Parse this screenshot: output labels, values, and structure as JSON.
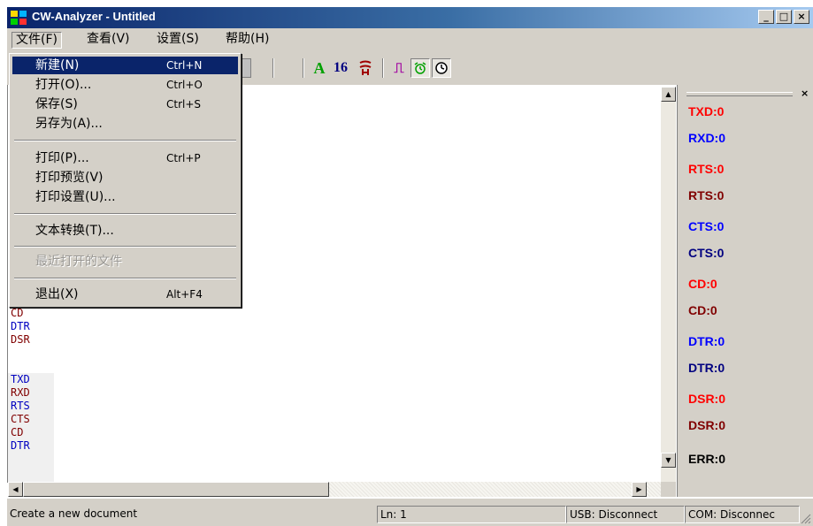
{
  "window": {
    "title": "CW-Analyzer - Untitled",
    "btn_min": "_",
    "btn_max": "□",
    "btn_close": "×"
  },
  "menubar": [
    {
      "label": "文件(F)"
    },
    {
      "label": "查看(V)"
    },
    {
      "label": "设置(S)"
    },
    {
      "label": "帮助(H)"
    }
  ],
  "toolbar": {
    "font_btn": "A",
    "hex_btn": "16",
    "pulse_btn": "⎍",
    "icons": [
      "font-icon",
      "hex-icon",
      "wave-icon",
      "pulse-icon",
      "alarm-icon",
      "clock-icon"
    ]
  },
  "file_menu": {
    "items": [
      {
        "label": "新建(N)",
        "shortcut": "Ctrl+N"
      },
      {
        "label": "打开(O)...",
        "shortcut": "Ctrl+O"
      },
      {
        "label": "保存(S)",
        "shortcut": "Ctrl+S"
      },
      {
        "label": "另存为(A)...",
        "shortcut": ""
      },
      {
        "label": "打印(P)...",
        "shortcut": "Ctrl+P"
      },
      {
        "label": "打印预览(V)",
        "shortcut": ""
      },
      {
        "label": "打印设置(U)...",
        "shortcut": ""
      },
      {
        "label": "文本转换(T)...",
        "shortcut": ""
      },
      {
        "label": "最近打开的文件",
        "shortcut": ""
      },
      {
        "label": "退出(X)",
        "shortcut": "Alt+F4"
      }
    ]
  },
  "signals_upper": [
    "CD",
    "DTR",
    "DSR"
  ],
  "signals_lower": [
    "TXD",
    "RXD",
    "RTS",
    "CTS",
    "CD",
    "DTR"
  ],
  "lamps": [
    {
      "label": "TXD:0",
      "color": "#ff0000"
    },
    {
      "label": "RXD:0",
      "color": "#0000ff"
    },
    {
      "label": "RTS:0",
      "color": "#ff0000"
    },
    {
      "label": "RTS:0",
      "color": "#800000"
    },
    {
      "label": "CTS:0",
      "color": "#0000ff"
    },
    {
      "label": "CTS:0",
      "color": "#000080"
    },
    {
      "label": "CD:0",
      "color": "#ff0000"
    },
    {
      "label": "CD:0",
      "color": "#800000"
    },
    {
      "label": "DTR:0",
      "color": "#0000ff"
    },
    {
      "label": "DTR:0",
      "color": "#000080"
    },
    {
      "label": "DSR:0",
      "color": "#ff0000"
    },
    {
      "label": "DSR:0",
      "color": "#800000"
    },
    {
      "label": "ERR:0",
      "color": "#000000"
    }
  ],
  "statusbar": {
    "message": "Create a new document",
    "line": "Ln: 1",
    "usb": "USB: Disconnect",
    "com": "COM: Disconnec"
  },
  "panel": {
    "close": "×"
  },
  "colors": {
    "selection": "#0a246a",
    "face": "#d4d0c8"
  }
}
